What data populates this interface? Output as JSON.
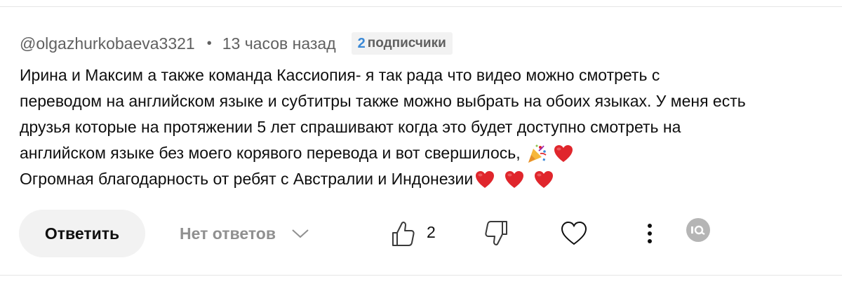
{
  "comment": {
    "author": "@olgazhurkobaeva3321",
    "separator": "•",
    "time": "13 часов назад",
    "subscribers_count": "2",
    "subscribers_label": "подписчики",
    "lines": [
      "Ирина и Максим а также команда Кассиопия- я так рада что видео можно смотреть с",
      "переводом на английском языке и субтитры также можно выбрать на обоих языках. У меня есть",
      "друзья которые на протяжении 5 лет спрашивают когда это будет доступно смотреть на",
      "английском языке без моего корявого перевода и вот свершилось,",
      "Огромная благодарность от ребят с Австралии и Индонезии"
    ]
  },
  "actions": {
    "reply_label": "Ответить",
    "no_replies_label": "Нет ответов",
    "like_count": "2"
  },
  "icons": {
    "party": "party-popper-icon",
    "heart_emoji": "red-heart-icon",
    "chevron": "chevron-down-icon",
    "like": "thumbs-up-icon",
    "dislike": "thumbs-down-icon",
    "heart": "heart-outline-icon",
    "more": "more-vertical-icon",
    "creator": "creator-avatar-icon"
  },
  "colors": {
    "text": "#0f0f0f",
    "secondary": "#606060",
    "muted": "#909090",
    "badge_bg": "#f2f2f2",
    "badge_count": "#3b89d6",
    "heart_red": "#e0262c"
  }
}
